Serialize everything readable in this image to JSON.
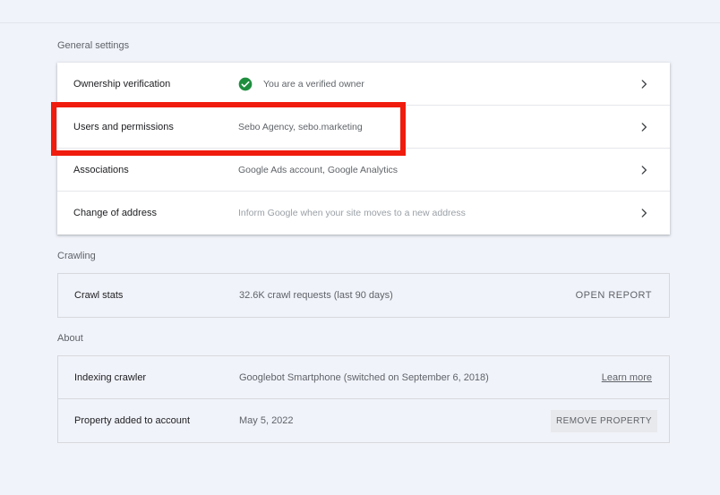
{
  "general": {
    "title": "General settings",
    "rows": [
      {
        "label": "Ownership verification",
        "value": "You are a verified owner"
      },
      {
        "label": "Users and permissions",
        "value": "Sebo Agency, sebo.marketing"
      },
      {
        "label": "Associations",
        "value": "Google Ads account, Google Analytics"
      },
      {
        "label": "Change of address",
        "value": "Inform Google when your site moves to a new address"
      }
    ]
  },
  "crawling": {
    "title": "Crawling",
    "rows": [
      {
        "label": "Crawl stats",
        "value": "32.6K crawl requests (last 90 days)",
        "action": "OPEN REPORT"
      }
    ]
  },
  "about": {
    "title": "About",
    "rows": [
      {
        "label": "Indexing crawler",
        "value": "Googlebot Smartphone (switched on September 6, 2018)",
        "action": "Learn more"
      },
      {
        "label": "Property added to account",
        "value": "May 5, 2022",
        "action": "REMOVE PROPERTY"
      }
    ]
  },
  "colors": {
    "background": "#f1f3fa",
    "verified_green": "#1e8e3e",
    "highlight_red": "#f01c0e"
  },
  "icons": {
    "verified": "check-circle-icon",
    "chevron": "chevron-right-icon"
  }
}
